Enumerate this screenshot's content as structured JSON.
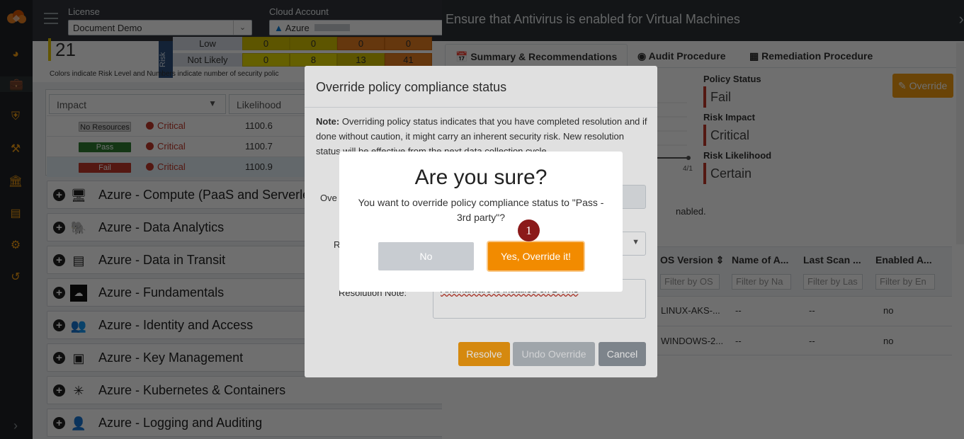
{
  "header": {
    "license_label": "License",
    "license_value": "Document Demo",
    "cloud_label": "Cloud Account",
    "cloud_value": "Azure"
  },
  "risk_matrix": {
    "count": "21",
    "axis_label": "Risk",
    "rows": [
      {
        "label": "Low",
        "values": [
          "0",
          "0",
          "0",
          "0"
        ]
      },
      {
        "label": "Not Likely",
        "values": [
          "0",
          "8",
          "13",
          "41"
        ]
      }
    ],
    "note": "Colors indicate Risk Level and Numbers indicate number of security polic"
  },
  "policy_table": {
    "filter_impact": "Impact",
    "filter_likelihood": "Likelihood",
    "rows": [
      {
        "badge": "No Resources",
        "impact": "Critical",
        "id": "1100.6"
      },
      {
        "badge": "Pass",
        "impact": "Critical",
        "id": "1100.7"
      },
      {
        "badge": "Fail",
        "impact": "Critical",
        "id": "1100.9"
      }
    ]
  },
  "categories": [
    {
      "label": "Azure - Compute (PaaS and Serverless",
      "icon": "compute-icon"
    },
    {
      "label": "Azure - Data Analytics",
      "icon": "elephant-icon"
    },
    {
      "label": "Azure - Data in Transit",
      "icon": "server-icon"
    },
    {
      "label": "Azure - Fundamentals",
      "icon": "cloud-icon"
    },
    {
      "label": "Azure - Identity and Access",
      "icon": "users-icon"
    },
    {
      "label": "Azure - Key Management",
      "icon": "key-vault-icon"
    },
    {
      "label": "Azure - Kubernetes & Containers",
      "icon": "kubernetes-icon"
    },
    {
      "label": "Azure - Logging and Auditing",
      "icon": "user-secret-icon"
    }
  ],
  "panel": {
    "title": "Ensure that Antivirus is enabled for Virtual Machines",
    "tabs": [
      "Summary & Recommendations",
      "Audit Procedure",
      "Remediation Procedure"
    ],
    "override_label": "Override",
    "policy_status_label": "Policy Status",
    "policy_status": "Fail",
    "risk_impact_label": "Risk Impact",
    "risk_impact": "Critical",
    "risk_likelihood_label": "Risk Likelihood",
    "risk_likelihood": "Certain",
    "chart_tick": "4/1",
    "partial_text": "nabled.",
    "columns": [
      "OS Version",
      "Name of A...",
      "Last Scan ...",
      "Enabled A..."
    ],
    "filters": [
      "Filter by OS",
      "Filter by Na",
      "Filter by Las",
      "Filter by En"
    ],
    "rows": [
      [
        "LINUX-AKS-...",
        "--",
        "--",
        "no"
      ],
      [
        "WINDOWS-2...",
        "--",
        "--",
        "no"
      ]
    ]
  },
  "override_modal": {
    "title": "Override policy compliance status",
    "note_bold": "Note:",
    "note_text": "Overriding policy status indicates that you have completed resolution and if done without caution, it might carry an inherent security risk. New resolution status will be effective from the next data collection cycle",
    "status_label": "Ove",
    "reason_label": "R",
    "resolution_label": "Resolution Note:",
    "resolution_value": "Antimalware is installed on 2 VMs",
    "resolve_label": "Resolve",
    "undo_label": "Undo Override",
    "cancel_label": "Cancel"
  },
  "confirm": {
    "title": "Are you sure?",
    "text": "You want to override policy compliance status to \"Pass - 3rd party\"?",
    "no_label": "No",
    "yes_label": "Yes, Override it!",
    "marker": "1"
  },
  "colors": {
    "accent": "#f39c12",
    "fail": "#c0392b",
    "pass": "#2e7d32",
    "nav_bg": "#1f2327"
  }
}
